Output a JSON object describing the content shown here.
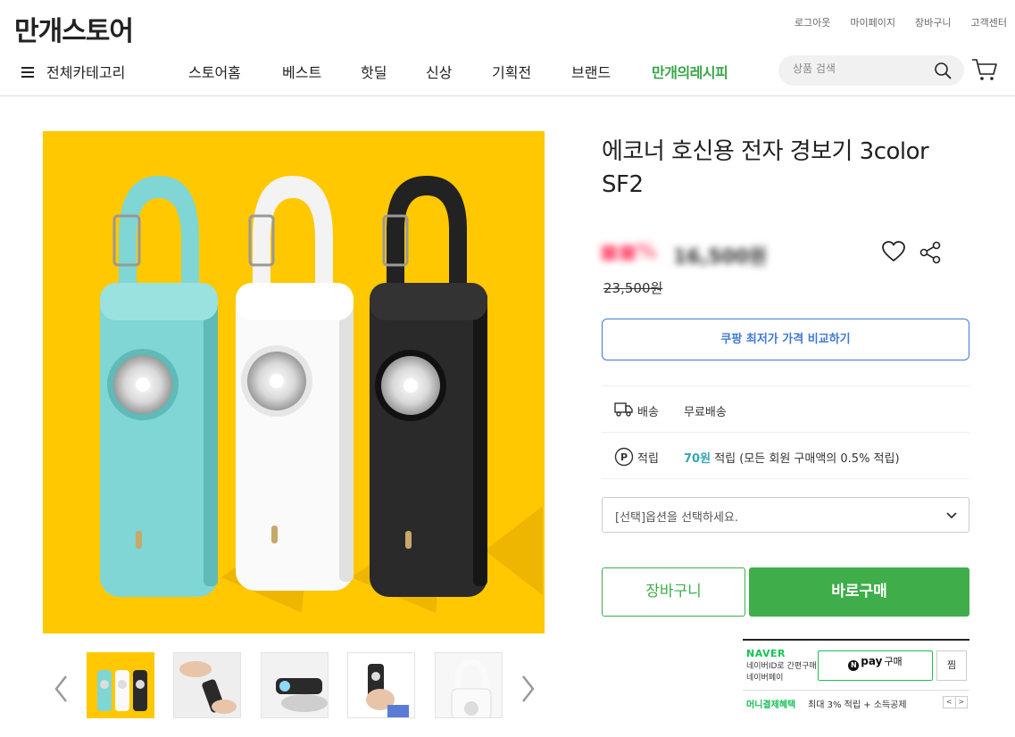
{
  "header": {
    "logo": "만개스토어",
    "util_links": [
      "로그아웃",
      "마이페이지",
      "장바구니",
      "고객센터"
    ],
    "all_category": "전체카테고리",
    "nav": [
      "스토어홈",
      "베스트",
      "핫딜",
      "신상",
      "기획전",
      "브랜드"
    ],
    "nav_special": "만개의레시피",
    "search_placeholder": "상품 검색"
  },
  "product": {
    "title": "에코너 호신용 전자 경보기 3color SF2",
    "discount_blurred": "■■%",
    "price_blurred": "16,500원",
    "original_price": "23,500원",
    "coupang_compare": "쿠팡 최저가 가격 비교하기",
    "shipping_label": "배송",
    "shipping_value": "무료배송",
    "points_label": "적립",
    "points_amount": "70원",
    "points_desc": " 적립 (모든 회원 구매액의 0.5% 적립)",
    "option_placeholder": "[선택]옵션을 선택하세요.",
    "cart_button": "장바구니",
    "buy_button": "바로구매"
  },
  "thumbnails": [
    "thumb-1",
    "thumb-2",
    "thumb-3",
    "thumb-4",
    "thumb-5"
  ],
  "naverpay": {
    "brand": "NAVER",
    "desc_line1": "네이버ID로 간편구매",
    "desc_line2": "네이버페이",
    "pay_n": "N",
    "pay_label": "pay",
    "pay_buy": "구매",
    "zzim": "찜",
    "benefit_label": "머니결제혜택",
    "benefit_desc": "최대 3% 적립 + 소득공제",
    "prev": "<",
    "next": ">"
  },
  "colors": {
    "accent_green": "#3fae4a",
    "naver_green": "#19c157",
    "coupang_blue": "#3f78d4",
    "image_bg": "#ffc800",
    "points_teal": "#36a5b5"
  }
}
